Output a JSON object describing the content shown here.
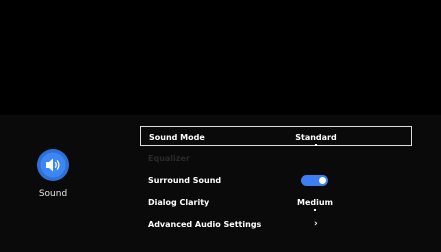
{
  "category": {
    "label": "Sound",
    "icon": "speaker-icon",
    "accent_color": "#3d7ef0"
  },
  "menu": {
    "items": [
      {
        "label": "Sound Mode",
        "value": "Standard",
        "selected": true
      },
      {
        "label": "Equalizer",
        "value": "",
        "disabled": true
      },
      {
        "label": "Surround Sound",
        "toggle": "on"
      },
      {
        "label": "Dialog Clarity",
        "value": "Medium"
      },
      {
        "label": "Advanced Audio Settings",
        "value": "›"
      }
    ]
  },
  "colors": {
    "background": "#000000",
    "toggle_on": "#3d7ef0",
    "selected_border": "#dcdcdc"
  }
}
